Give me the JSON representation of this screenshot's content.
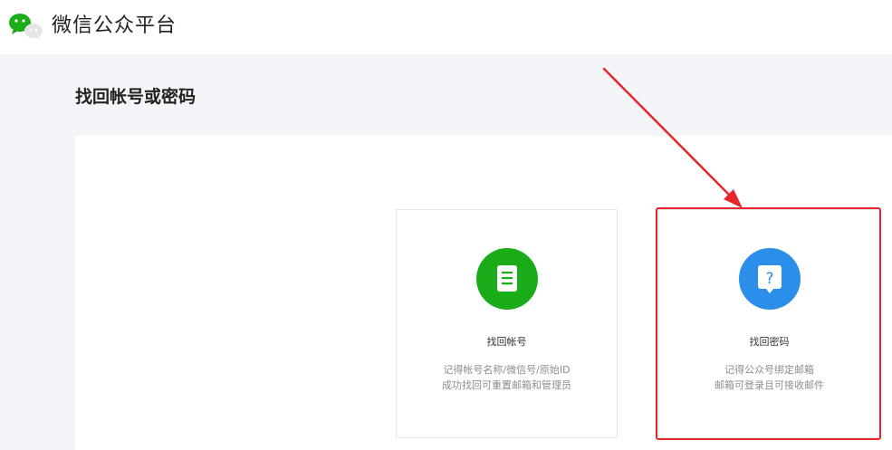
{
  "header": {
    "title": "微信公众平台",
    "logo_icon": "wechat-logo-icon"
  },
  "page": {
    "title": "找回帐号或密码"
  },
  "cards": [
    {
      "icon": "document-icon",
      "color": "#1aad19",
      "title": "找回帐号",
      "desc_line1": "记得帐号名称/微信号/原始ID",
      "desc_line2": "成功找回可重置邮箱和管理员"
    },
    {
      "icon": "question-bubble-icon",
      "color": "#2b8ee8",
      "title": "找回密码",
      "desc_line1": "记得公众号绑定邮箱",
      "desc_line2": "邮箱可登录且可接收邮件"
    }
  ],
  "annotation": {
    "color": "#e8262a"
  }
}
